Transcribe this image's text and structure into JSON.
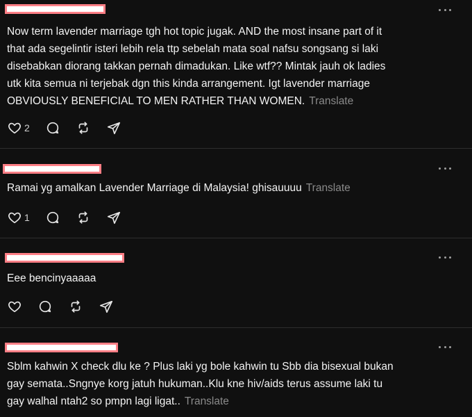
{
  "translate_label": "Translate",
  "more_glyph": "...",
  "colors": {
    "background": "#101010",
    "text": "#f3f3f3",
    "muted": "#8a8a8a",
    "redaction_border": "#ff7f86"
  },
  "comments": [
    {
      "text": "Now term lavender marriage tgh hot topic jugak. AND the most insane part of it\nthat ada segelintir isteri lebih rela ttp sebelah mata soal nafsu songsang si laki\ndisebabkan diorang takkan pernah dimadukan. Like wtf?? Mintak jauh ok ladies\nutk kita semua ni terjebak dgn this kinda arrangement. Igt lavender marriage\nOBVIOUSLY BENEFICIAL TO MEN RATHER THAN WOMEN.",
      "like_count": "2",
      "show_translate": true,
      "icons": [
        "heart-icon",
        "comment-icon",
        "repost-icon",
        "share-icon"
      ]
    },
    {
      "text": "Ramai yg amalkan Lavender Marriage di Malaysia! ghisauuuu",
      "like_count": "1",
      "show_translate": true,
      "icons": [
        "heart-icon",
        "comment-icon",
        "repost-icon",
        "share-icon"
      ]
    },
    {
      "text": "Eee bencinyaaaaa",
      "like_count": "",
      "show_translate": false,
      "icons": [
        "heart-icon",
        "comment-icon",
        "repost-icon",
        "share-icon"
      ]
    },
    {
      "text": "Sblm kahwin X check dlu ke ? Plus laki yg bole kahwin tu Sbb dia bisexual bukan\ngay semata..Sngnye korg jatuh hukuman..Klu kne hiv/aids terus assume laki tu\ngay walhal ntah2 so pmpn lagi ligat..",
      "like_count": "",
      "show_translate": true,
      "icons": [
        "heart-icon",
        "comment-icon",
        "repost-icon",
        "share-icon"
      ]
    }
  ]
}
